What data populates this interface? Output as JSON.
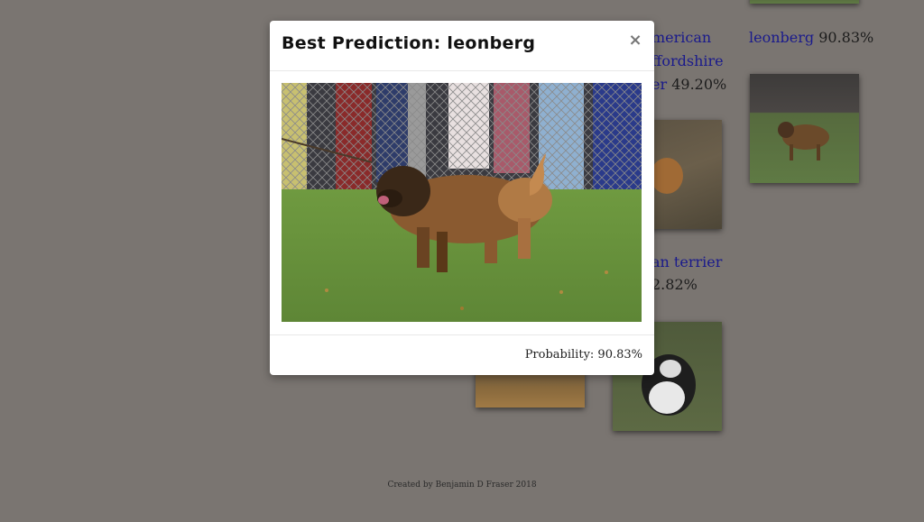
{
  "gallery": {
    "items": [
      {
        "breed": "merican staffordshire terrier",
        "lines": [
          "merican",
          "ffordshire"
        ],
        "tail": "er",
        "prob": "49.20%"
      },
      {
        "breed": "leonberg",
        "prob": "90.83%"
      },
      {
        "breed": "an terrier",
        "prob": "2.82%"
      }
    ]
  },
  "modal": {
    "title": "Best Prediction: leonberg",
    "close_glyph": "×",
    "probability": "Probability: 90.83%"
  },
  "footer": {
    "credit": "Created by Benjamin D Fraser 2018"
  },
  "colors": {
    "backdrop": "#7a7571",
    "link": "#1a1a8c"
  }
}
